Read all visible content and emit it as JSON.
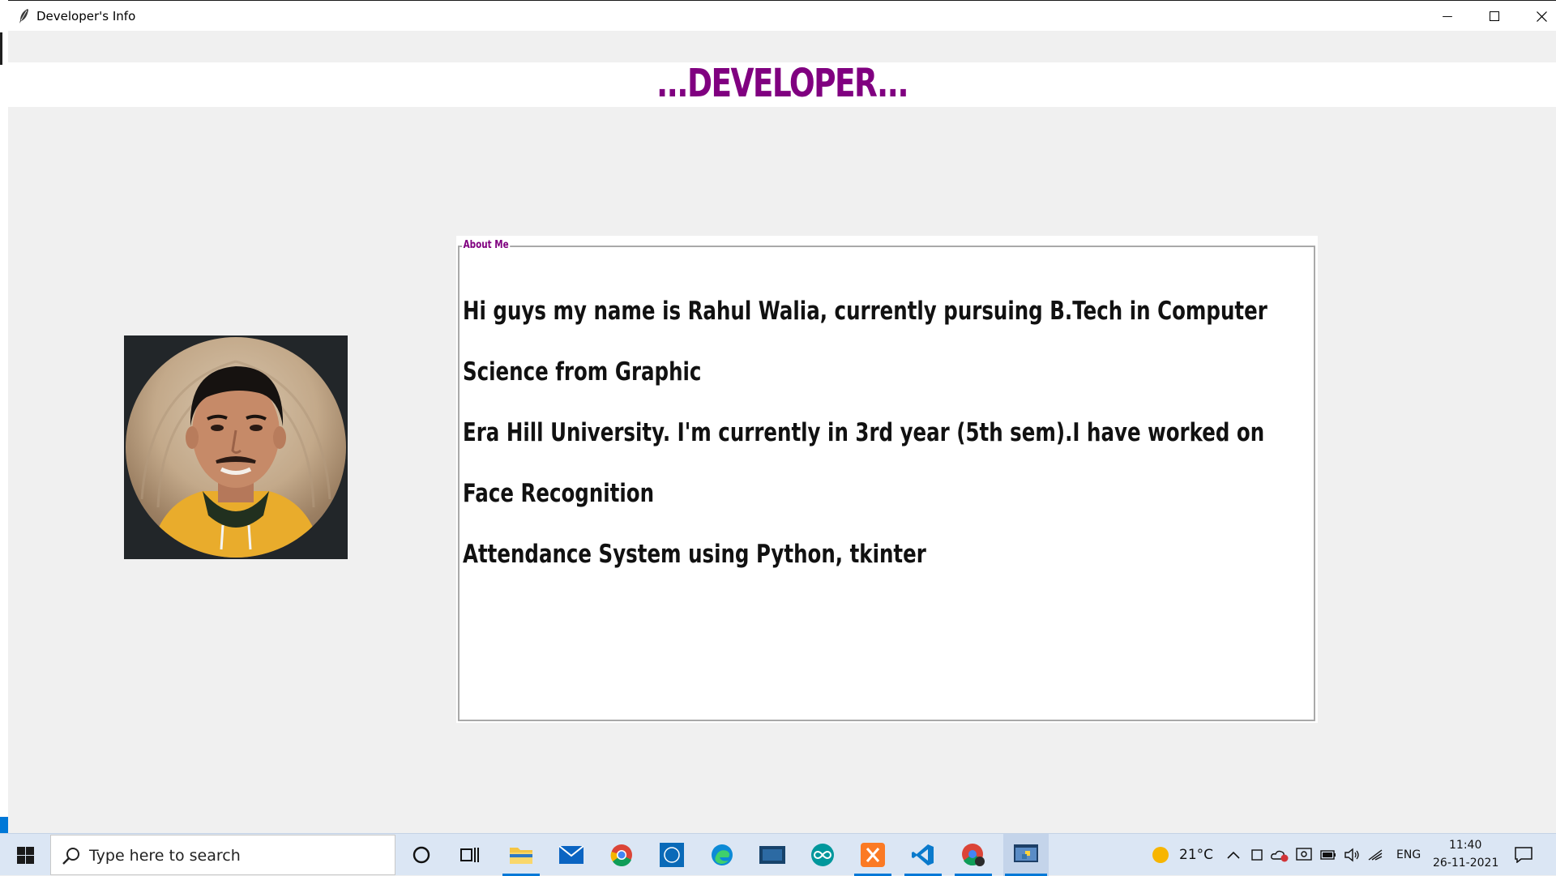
{
  "window": {
    "title": "Developer's Info",
    "minimize_glyph": "—",
    "maximize_glyph": "☐",
    "close_glyph": "✕"
  },
  "header": {
    "heading": "...DEVELOPER..."
  },
  "about": {
    "legend": "About Me",
    "text": "Hi guys my name is Rahul Walia, currently pursuing B.Tech in Computer Science from Graphic\nEra Hill University. I'm currently in 3rd year (5th sem).I have worked on Face Recognition\nAttendance System using Python, tkinter"
  },
  "taskbar": {
    "search_placeholder": "Type here to search",
    "weather": "21°C",
    "language": "ENG",
    "time": "11:40",
    "date": "26-11-2021"
  },
  "colors": {
    "heading": "#800080",
    "taskbar": "#dbe6f4",
    "accent": "#0078d7"
  }
}
